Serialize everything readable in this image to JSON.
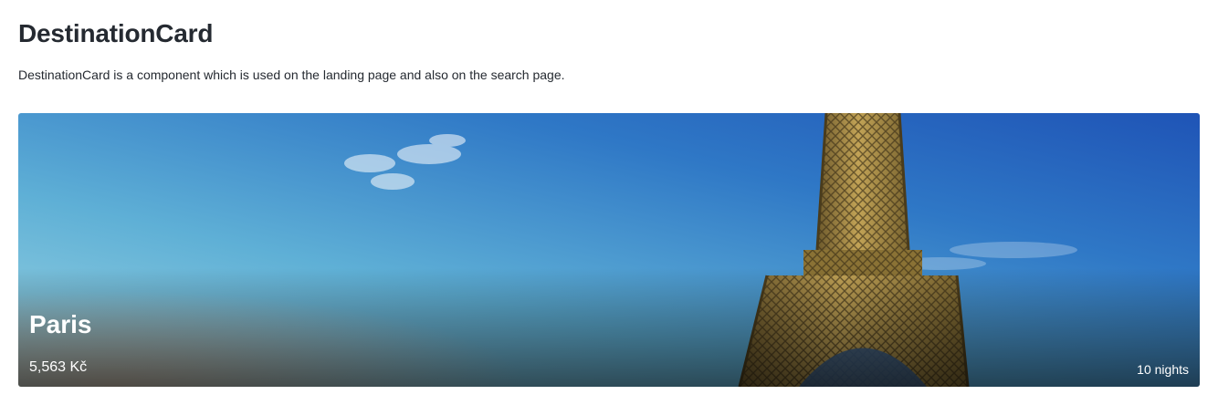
{
  "header": {
    "title": "DestinationCard",
    "description": "DestinationCard is a component which is used on the landing page and also on the search page."
  },
  "card": {
    "city": "Paris",
    "price": "5,563 Kč",
    "nights": "10 nights",
    "image": "eiffel-tower-photo"
  },
  "colors": {
    "text": "#252a31",
    "card_text": "#ffffff",
    "sky_light": "#8fd0e0",
    "sky_dark": "#1f56b8",
    "tower": "#b89a4a"
  }
}
